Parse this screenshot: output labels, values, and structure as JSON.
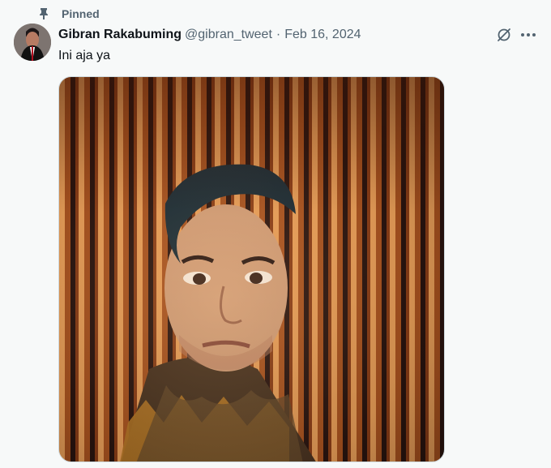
{
  "pinned": {
    "label": "Pinned",
    "icon": "pin-icon"
  },
  "tweet": {
    "author_name": "Gibran Rakabuming",
    "handle": "@gibran_tweet",
    "separator": "·",
    "date": "Feb 16, 2024",
    "text": "Ini aja ya"
  },
  "icons": {
    "grok": "grok-icon",
    "more": "more-icon",
    "avatar": "avatar"
  },
  "colors": {
    "background": "#f7f9f9",
    "muted_text": "#536471",
    "text": "#0f1419"
  }
}
